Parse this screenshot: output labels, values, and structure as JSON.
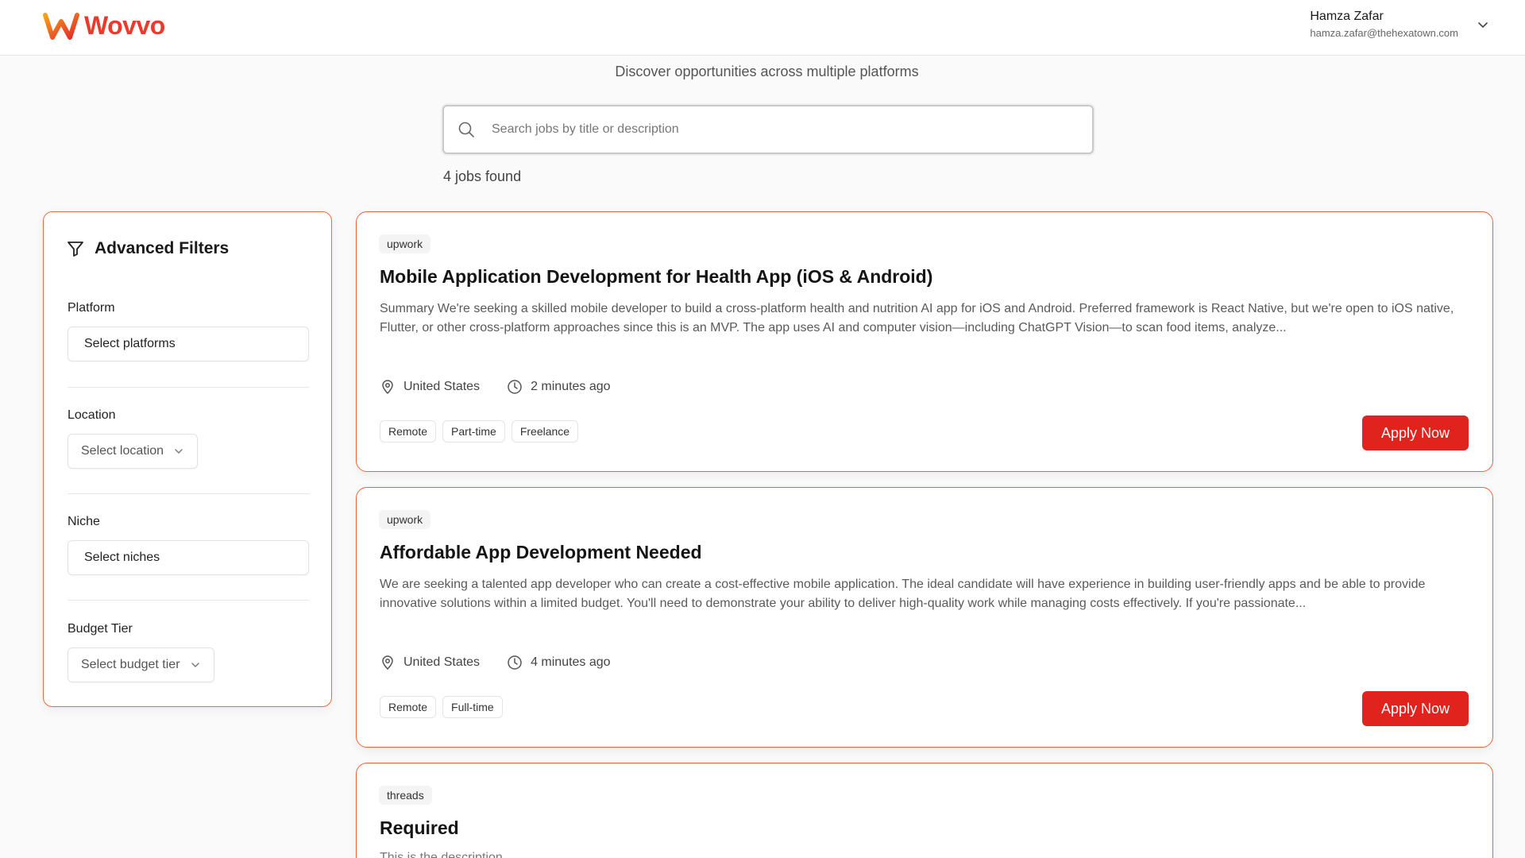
{
  "header": {
    "brand": "Wovvo",
    "user_name": "Hamza Zafar",
    "user_email": "hamza.zafar@thehexatown.com"
  },
  "hero": {
    "subtitle": "Discover opportunities across multiple platforms",
    "search_placeholder": "Search jobs by title or description",
    "jobs_count": "4 jobs found"
  },
  "filters": {
    "title": "Advanced Filters",
    "platform_label": "Platform",
    "platform_value": "Select platforms",
    "location_label": "Location",
    "location_value": "Select location",
    "niche_label": "Niche",
    "niche_value": "Select niches",
    "budget_label": "Budget Tier",
    "budget_value": "Select budget tier"
  },
  "jobs": [
    {
      "platform": "upwork",
      "title": "Mobile Application Development for Health App (iOS & Android)",
      "description": "Summary We're seeking a skilled mobile developer to build a cross-platform health and nutrition AI app for iOS and Android. Preferred framework is React Native, but we're open to iOS native, Flutter, or other cross-platform approaches since this is an MVP. The app uses AI and computer vision—including ChatGPT Vision—to scan food items, analyze...",
      "location": "United States",
      "time": "2 minutes ago",
      "tags": [
        "Remote",
        "Part-time",
        "Freelance"
      ],
      "apply_label": "Apply Now"
    },
    {
      "platform": "upwork",
      "title": "Affordable App Development Needed",
      "description": "We are seeking a talented app developer who can create a cost-effective mobile application. The ideal candidate will have experience in building user-friendly apps and be able to provide innovative solutions within a limited budget. You'll need to demonstrate your ability to deliver high-quality work while managing costs effectively. If you're passionate...",
      "location": "United States",
      "time": "4 minutes ago",
      "tags": [
        "Remote",
        "Full-time"
      ],
      "apply_label": "Apply Now"
    },
    {
      "platform": "threads",
      "title": "Required",
      "description": "This is the description"
    }
  ],
  "colors": {
    "brand": "#ea3b2a",
    "accent_border": "#f0623a",
    "apply_button": "#e0231d"
  },
  "icons": {
    "logo": "wovvo-logo-icon",
    "search": "search-icon",
    "filter": "filter-icon",
    "location": "map-pin-icon",
    "time": "clock-icon",
    "chevron": "chevron-down-icon"
  }
}
